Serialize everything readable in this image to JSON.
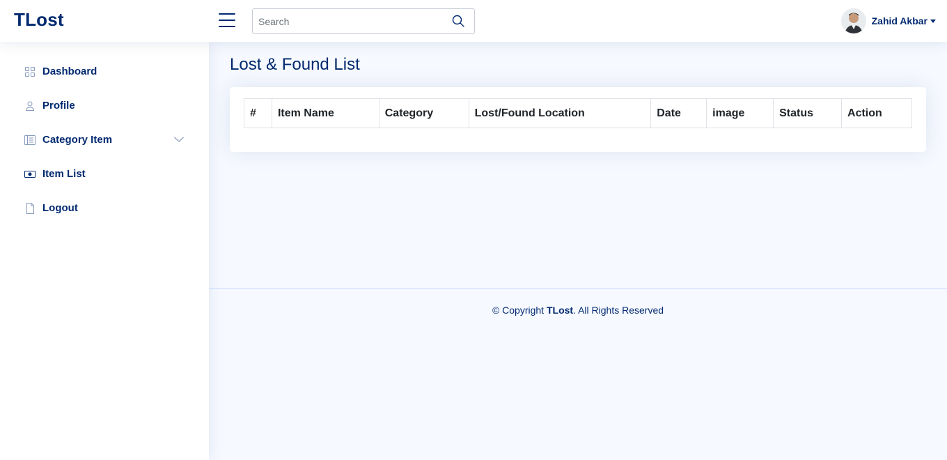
{
  "app": {
    "logo": "TLost"
  },
  "header": {
    "search_placeholder": "Search",
    "user_name": "Zahid Akbar"
  },
  "sidebar": {
    "items": [
      {
        "label": "Dashboard",
        "icon": "grid-icon"
      },
      {
        "label": "Profile",
        "icon": "person-icon"
      },
      {
        "label": "Category Item",
        "icon": "layout-text-icon",
        "expandable": true
      },
      {
        "label": "Item List",
        "icon": "cash-icon"
      },
      {
        "label": "Logout",
        "icon": "file-icon"
      }
    ]
  },
  "main": {
    "title": "Lost & Found List",
    "table": {
      "columns": [
        "#",
        "Item Name",
        "Category",
        "Lost/Found Location",
        "Date",
        "image",
        "Status",
        "Action"
      ],
      "rows": []
    }
  },
  "footer": {
    "prefix": "© Copyright ",
    "brand": "TLost",
    "suffix": ". All Rights Reserved"
  },
  "colors": {
    "primary": "#012970",
    "background": "#f6f9ff",
    "accent": "#4154f1"
  }
}
